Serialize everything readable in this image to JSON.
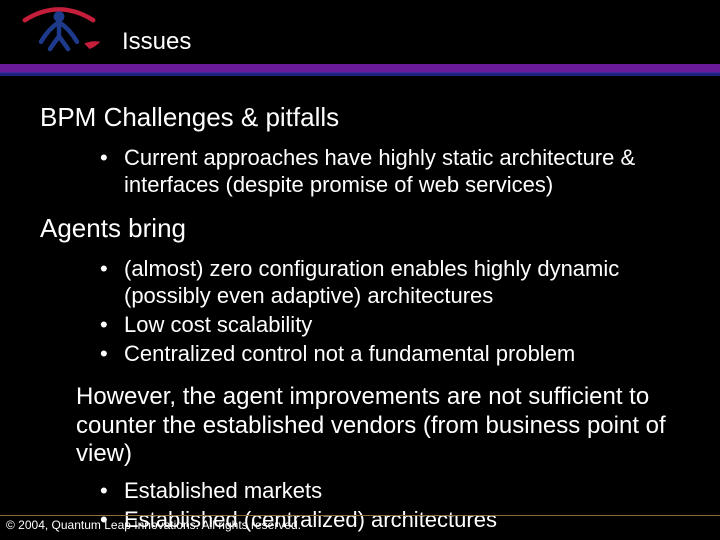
{
  "header": {
    "title": "Issues"
  },
  "sections": {
    "s1": {
      "heading": "BPM Challenges & pitfalls",
      "bullets": [
        "Current approaches have highly static architecture & interfaces (despite promise of web services)"
      ]
    },
    "s2": {
      "heading": "Agents bring",
      "bullets": [
        "(almost) zero configuration enables highly dynamic (possibly even adaptive) architectures",
        "Low cost scalability",
        "Centralized control not a fundamental problem"
      ]
    },
    "s3": {
      "para": "However, the agent improvements are not sufficient to counter the established vendors (from business point of view)",
      "bullets": [
        "Established markets",
        "Established (centralized) architectures"
      ]
    }
  },
  "footer": {
    "copyright": "© 2004, Quantum Leap Innovations. All rights reserved."
  }
}
